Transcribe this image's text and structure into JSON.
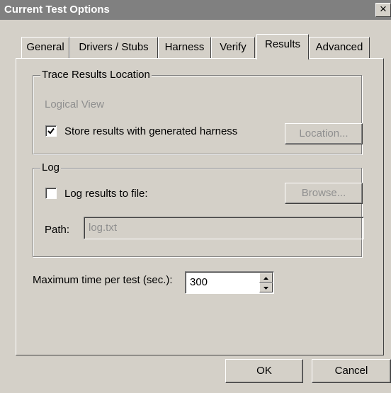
{
  "window": {
    "title": "Current Test Options",
    "close_glyph": "×"
  },
  "tabs": [
    {
      "label": "General"
    },
    {
      "label": "Drivers / Stubs"
    },
    {
      "label": "Harness"
    },
    {
      "label": "Verify"
    },
    {
      "label": "Results",
      "active": true
    },
    {
      "label": "Advanced"
    }
  ],
  "trace_results": {
    "title": "Trace Results Location",
    "logical_view_label": "Logical View",
    "store_with_harness_label": "Store results with generated harness",
    "store_with_harness_checked": true,
    "location_button": "Location..."
  },
  "log": {
    "title": "Log",
    "log_to_file_label": "Log results to file:",
    "log_to_file_checked": false,
    "browse_button": "Browse...",
    "path_label": "Path:",
    "path_value": "log.txt"
  },
  "max_time": {
    "label": "Maximum time per test (sec.):",
    "value": "300"
  },
  "buttons": {
    "ok": "OK",
    "cancel": "Cancel"
  },
  "icons": {
    "close": "close-icon",
    "check": "checkmark-icon",
    "spin_up": "spin-up-icon",
    "spin_down": "spin-down-icon"
  }
}
